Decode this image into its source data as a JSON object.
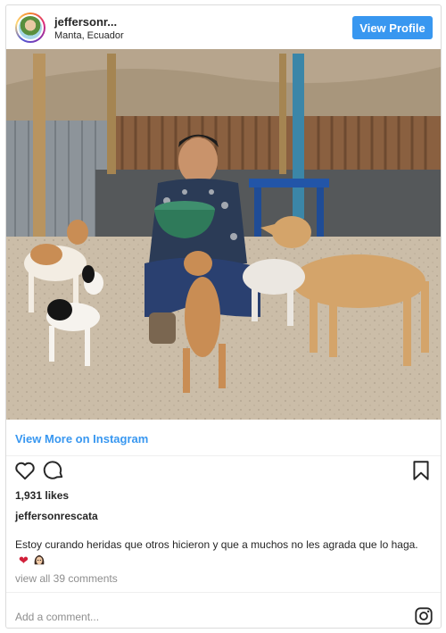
{
  "header": {
    "username": "jeffersonr...",
    "location": "Manta, Ecuador",
    "view_profile_label": "View Profile"
  },
  "post": {
    "view_more_label": "View More on Instagram",
    "likes": "1,931 likes",
    "author": "jeffersonrescata",
    "caption": "Estoy curando heridas que otros hicieron y que a muchos no les agrada que lo haga.",
    "view_comments": "view all 39 comments",
    "add_comment_placeholder": "Add a comment..."
  },
  "icons": {
    "like": "heart-outline",
    "comment": "speech-bubble",
    "save": "bookmark",
    "brand": "instagram-logo",
    "caption_emoji_1": "red-heart",
    "caption_emoji_2": "woman-face"
  },
  "colors": {
    "accent": "#3897f0",
    "text": "#262626",
    "muted": "#8e8e8e",
    "border": "#dbdbdb"
  }
}
